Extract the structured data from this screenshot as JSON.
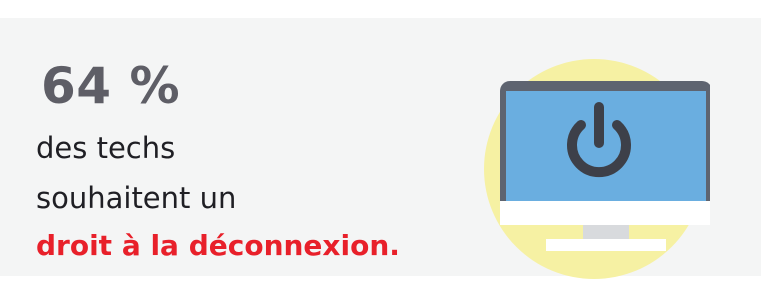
{
  "stat": {
    "value": "64 %"
  },
  "text": {
    "line1": "des techs",
    "line2": "souhaitent un",
    "emphasis": "droit à la déconnexion."
  },
  "colors": {
    "background": "#f4f5f5",
    "stat": "#5e5e66",
    "body_text": "#1f1f24",
    "emphasis": "#e8202a",
    "halo": "#f6f1a3",
    "monitor_frame": "#5e6470",
    "screen": "#6aaee0",
    "power_icon": "#3d4049",
    "stand": "#d8dadd"
  },
  "icons": {
    "illustration": "computer-monitor-icon",
    "power": "power-icon"
  }
}
